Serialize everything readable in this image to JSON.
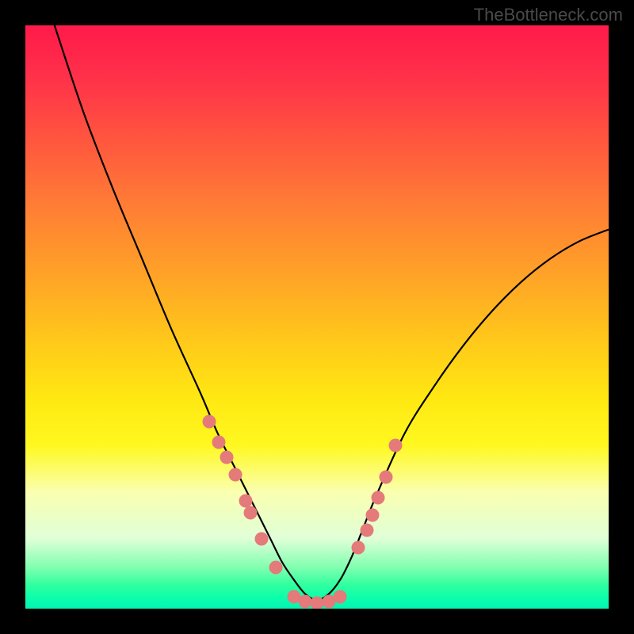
{
  "watermark": "TheBottleneck.com",
  "chart_data": {
    "type": "line",
    "title": "",
    "xlabel": "",
    "ylabel": "",
    "xlim": [
      0,
      100
    ],
    "ylim": [
      0,
      100
    ],
    "series": [
      {
        "name": "curve",
        "type": "line",
        "x": [
          5,
          10,
          15,
          20,
          25,
          30,
          33,
          36,
          39,
          42,
          44,
          46,
          48,
          50,
          52,
          54,
          56,
          58,
          60,
          65,
          70,
          75,
          80,
          85,
          90,
          95,
          100
        ],
        "y": [
          100,
          85,
          72,
          60,
          48,
          37,
          30,
          24,
          18,
          12,
          8,
          5,
          2.5,
          1.5,
          2.5,
          5,
          9,
          14,
          19,
          30,
          38,
          45,
          51,
          56,
          60,
          63,
          65
        ]
      },
      {
        "name": "points-left",
        "type": "scatter",
        "x": [
          31.5,
          33.2,
          34.5,
          36.0,
          37.8,
          38.6,
          40.5,
          43.0
        ],
        "y": [
          32.0,
          28.5,
          26.0,
          23.0,
          18.5,
          16.5,
          12.0,
          7.0
        ]
      },
      {
        "name": "points-bottom",
        "type": "scatter",
        "x": [
          46.0,
          48.0,
          50.0,
          52.0,
          54.0
        ],
        "y": [
          2.0,
          1.2,
          1.0,
          1.2,
          2.0
        ]
      },
      {
        "name": "points-right",
        "type": "scatter",
        "x": [
          57.0,
          58.5,
          59.5,
          60.5,
          61.8,
          63.5
        ],
        "y": [
          10.5,
          13.5,
          16.0,
          19.0,
          22.5,
          28.0
        ]
      }
    ],
    "colors": {
      "curve": "#000000",
      "points": "#e47a7a",
      "gradient_top": "#ff1a4a",
      "gradient_bottom": "#04f4b2"
    }
  }
}
